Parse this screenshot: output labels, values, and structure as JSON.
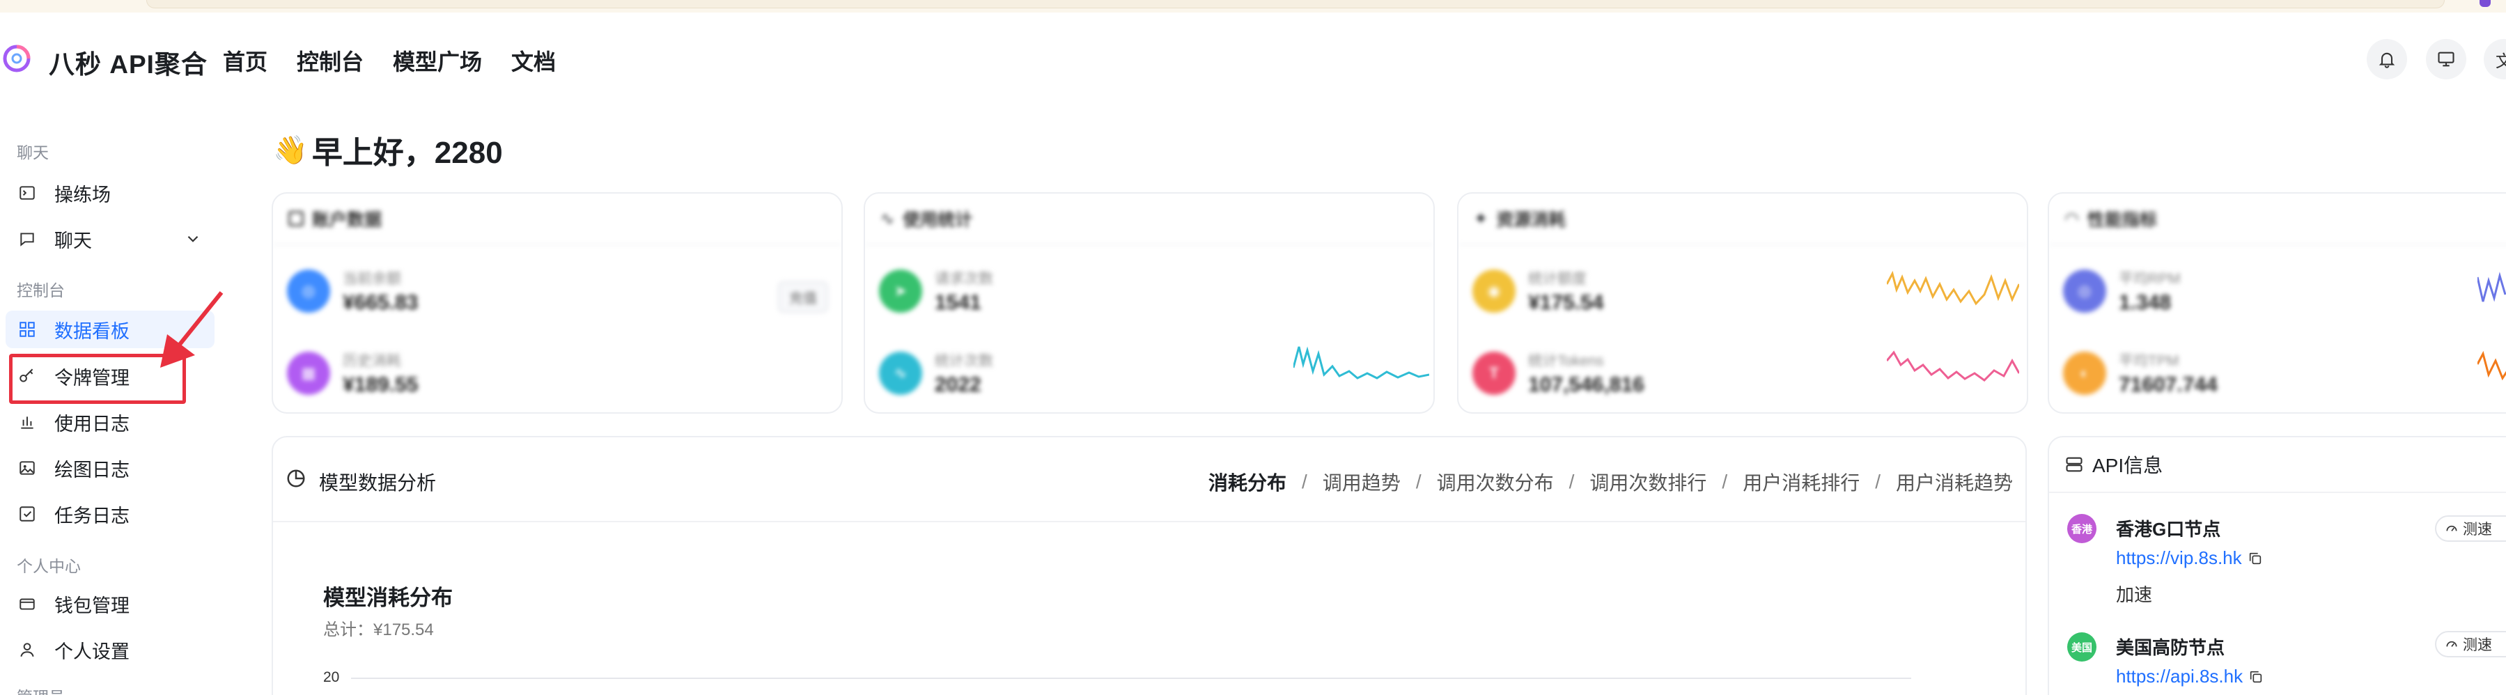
{
  "app": {
    "brand": "八秒 API聚合",
    "nav": [
      "首页",
      "控制台",
      "模型广场",
      "文档"
    ]
  },
  "sidebar": {
    "section_chat": "聊天",
    "section_console": "控制台",
    "section_personal": "个人中心",
    "section_admin": "管理员",
    "items": {
      "playground": "操练场",
      "chat": "聊天",
      "dashboard": "数据看板",
      "token_mgmt": "令牌管理",
      "usage_log": "使用日志",
      "drawing_log": "绘图日志",
      "task_log": "任务日志",
      "wallet": "钱包管理",
      "settings": "个人设置"
    }
  },
  "greeting": "早上好，2280",
  "cards": {
    "account": {
      "title": "账户数据",
      "balance_label": "当前余额",
      "balance_value": "¥665.83",
      "recharge_btn": "充值",
      "spent_label": "历史消耗",
      "spent_value": "¥189.55"
    },
    "usage": {
      "title": "使用统计",
      "req_label": "请求次数",
      "req_value": "1541",
      "calls_label": "统计次数",
      "calls_value": "2022"
    },
    "resource": {
      "title": "资源消耗",
      "quota_label": "统计额度",
      "quota_value": "¥175.54",
      "tokens_label": "统计Tokens",
      "tokens_value": "107,546,816"
    },
    "perf": {
      "title": "性能指标",
      "rpm_label": "平均RPM",
      "rpm_value": "1.348",
      "tpm_label": "平均TPM",
      "tpm_value": "71607.744"
    }
  },
  "analysis": {
    "title": "模型数据分析",
    "tabs": [
      "消耗分布",
      "调用趋势",
      "调用次数分布",
      "调用次数排行",
      "用户消耗排行",
      "用户消耗趋势"
    ],
    "active_tab": "消耗分布",
    "chart_title": "模型消耗分布",
    "chart_subtitle": "总计：¥175.54",
    "y_tick": "20"
  },
  "api_info": {
    "title": "API信息",
    "speed_label": "测速",
    "nodes": [
      {
        "avatar": "香港",
        "name": "香港G口节点",
        "url": "https://vip.8s.hk",
        "desc": "加速",
        "color": "#c05bd6"
      },
      {
        "avatar": "美国",
        "name": "美国高防节点",
        "url": "https://api.8s.hk",
        "desc": "",
        "color": "#36c26b"
      }
    ]
  },
  "colors": {
    "accent": "#1f6fff",
    "highlight": "#e8313f"
  }
}
